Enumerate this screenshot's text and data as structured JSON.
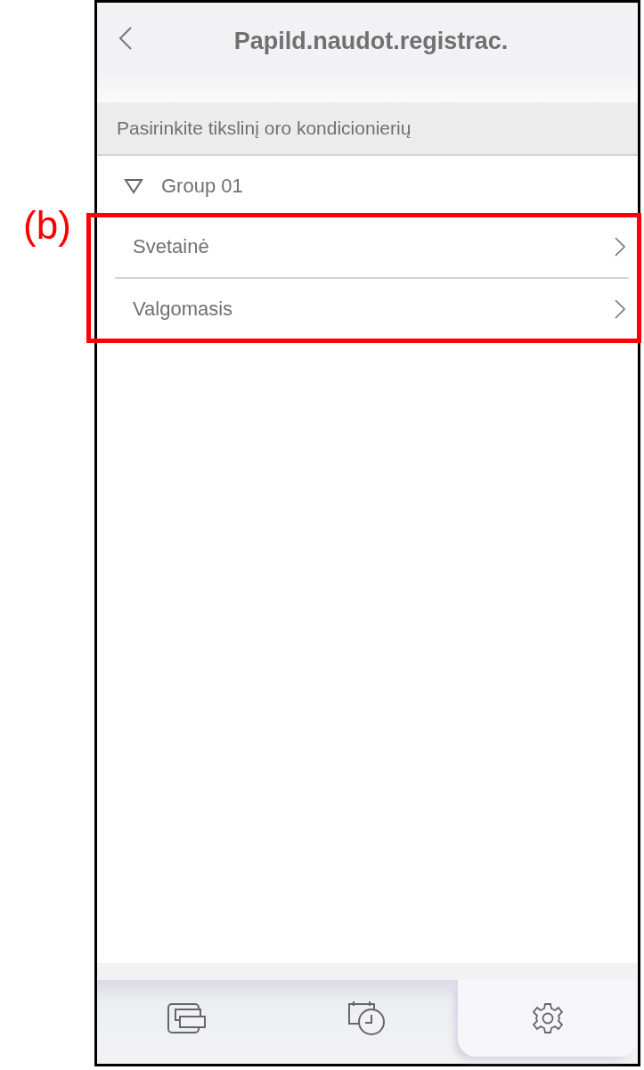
{
  "figure_label": "(b)",
  "header": {
    "title": "Papild.naudot.registrac."
  },
  "section_title": "Pasirinkite tikslinį oro kondicionierių",
  "group": {
    "label": "Group 01",
    "expanded": true,
    "items": [
      {
        "label": "Svetainė"
      },
      {
        "label": "Valgomasis"
      }
    ]
  },
  "tab_bar": [
    {
      "kind": "devices",
      "selected": false
    },
    {
      "kind": "schedule",
      "selected": false
    },
    {
      "kind": "settings",
      "selected": true
    }
  ]
}
